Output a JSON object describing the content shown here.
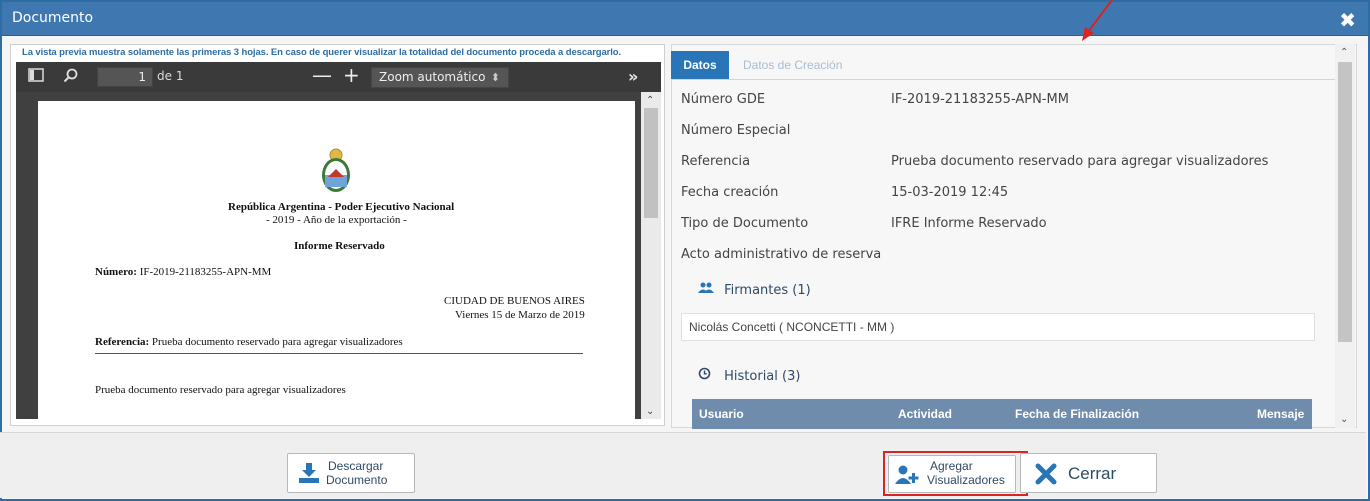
{
  "dialog": {
    "title": "Documento",
    "close_glyph": "✖"
  },
  "preview": {
    "notice": "La vista previa muestra solamente las primeras 3 hojas. En caso de querer visualizar la totalidad del documento proceda a descargarlo.",
    "toolbar": {
      "page_value": "1",
      "page_of": "de 1",
      "zoom_minus": "—",
      "zoom_plus": "+",
      "zoom_select": "Zoom automático",
      "icons": [
        "sidebar-toggle-icon",
        "search-icon",
        "more-tools-icon"
      ]
    },
    "document": {
      "header_line1": "República Argentina - Poder Ejecutivo Nacional",
      "header_line2": "- 2019 - Año de la exportación -",
      "doc_type": "Informe Reservado",
      "numero_label": "Número:",
      "numero_value": "IF-2019-21183255-APN-MM",
      "city": "CIUDAD DE BUENOS AIRES",
      "date": "Viernes 15 de Marzo de 2019",
      "referencia_label": "Referencia:",
      "referencia_value": "Prueba documento reservado para agregar visualizadores",
      "body": "Prueba documento reservado para agregar visualizadores"
    }
  },
  "datos": {
    "tabs": [
      {
        "label": "Datos",
        "active": true
      },
      {
        "label": "Datos de Creación",
        "active": false
      }
    ],
    "fields": [
      {
        "label": "Número GDE",
        "value": "IF-2019-21183255-APN-MM"
      },
      {
        "label": "Número Especial",
        "value": ""
      },
      {
        "label": "Referencia",
        "value": "Prueba documento reservado para agregar visualizadores"
      },
      {
        "label": "Fecha creación",
        "value": "15-03-2019 12:45"
      },
      {
        "label": "Tipo de Documento",
        "value": "IFRE Informe Reservado"
      },
      {
        "label": "Acto administrativo de reserva",
        "value": ""
      }
    ],
    "firmantes": {
      "title": "Firmantes (1)",
      "items": [
        "Nicolás Concetti ( NCONCETTI - MM )"
      ]
    },
    "historial": {
      "title": "Historial (3)",
      "columns": [
        "Usuario",
        "Actividad",
        "Fecha de Finalización",
        "Mensaje"
      ]
    }
  },
  "footer": {
    "descargar": {
      "line1": "Descargar",
      "line2": "Documento"
    },
    "agregar": {
      "line1": "Agregar",
      "line2": "Visualizadores"
    },
    "cerrar": "Cerrar"
  },
  "colors": {
    "titlebar": "#3f78b0",
    "tab_active": "#2a75b8",
    "table_header": "#6f8cad",
    "highlight": "#d92424"
  }
}
